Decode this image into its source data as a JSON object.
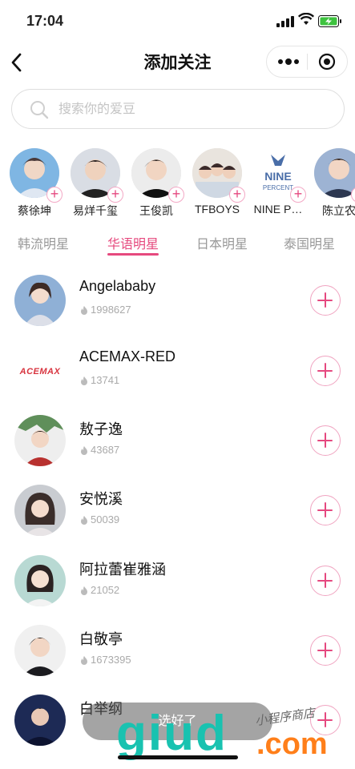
{
  "status_bar": {
    "time": "17:04"
  },
  "nav": {
    "title": "添加关注"
  },
  "search": {
    "placeholder": "搜索你的爱豆"
  },
  "stars": [
    {
      "name": "蔡徐坤"
    },
    {
      "name": "易烊千玺"
    },
    {
      "name": "王俊凯"
    },
    {
      "name": "TFBOYS"
    },
    {
      "name": "NINE P…",
      "logo_text": "NINE PERCENT"
    },
    {
      "name": "陈立农"
    }
  ],
  "tabs": [
    "韩流明星",
    "华语明星",
    "日本明星",
    "泰国明星"
  ],
  "active_tab": "华语明星",
  "list": [
    {
      "name": "Angelababy",
      "count": "1998627"
    },
    {
      "name": "ACEMAX-RED",
      "count": "13741",
      "logo_text": "ACEMAX"
    },
    {
      "name": "敖子逸",
      "count": "43687"
    },
    {
      "name": "安悦溪",
      "count": "50039"
    },
    {
      "name": "阿拉蕾崔雅涵",
      "count": "21052"
    },
    {
      "name": "白敬亭",
      "count": "1673395"
    },
    {
      "name": "白举纲",
      "count": ""
    }
  ],
  "toast": {
    "text": "选好了"
  },
  "watermark": {
    "main": "giud",
    "suffix": ".com",
    "tag": "小程序商店"
  },
  "colors": {
    "accent": "#e6497e",
    "accent_light": "#f0a4c1",
    "muted": "#999999"
  }
}
